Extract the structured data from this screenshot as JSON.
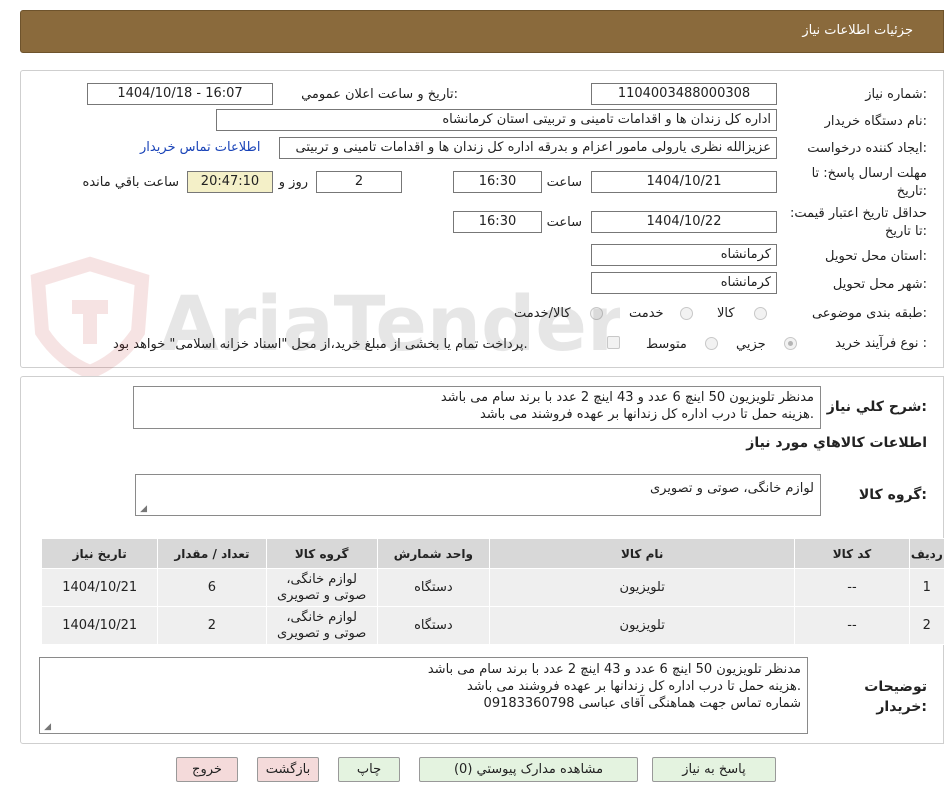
{
  "header": {
    "title": "جزئیات اطلاعات نیاز"
  },
  "form": {
    "need_number_label": "شماره نیاز:",
    "need_number": "1104003488000308",
    "announce_label": "تاریخ و ساعت اعلان عمومي:",
    "announce_value": "1404/10/18 - 16:07",
    "buyer_org_label": "نام دستگاه خریدار:",
    "buyer_org": "اداره کل زندان ها و اقدامات تامینی و تربیتی استان کرمانشاه",
    "requester_label": "ایجاد کننده درخواست:",
    "requester": "عزیزالله نظری یارولی مامور اعزام و بدرقه اداره کل زندان ها و اقدامات تامینی و تربیتی",
    "buyer_contact_link": "اطلاعات تماس خریدار",
    "reply_deadline_label": "مهلت ارسال پاسخ: تا تاریخ:",
    "reply_date": "1404/10/21",
    "time_label": "ساعت",
    "reply_time": "16:30",
    "days": "2",
    "days_label": "روز و",
    "remaining_time": "20:47:10",
    "remaining_label": "ساعت باقي مانده",
    "price_validity_label": "حداقل تاریخ اعتبار قیمت: تا تاریخ:",
    "validity_date": "1404/10/22",
    "validity_time": "16:30",
    "province_label": "استان محل تحویل:",
    "province": "کرمانشاه",
    "city_label": "شهر محل تحویل:",
    "city": "کرمانشاه",
    "category_label": "طبقه بندی موضوعی:",
    "category_options": [
      "کالا",
      "خدمت",
      "کالا/خدمت"
    ],
    "process_label": "نوع فرآیند خرید :",
    "process_options": [
      "جزیي",
      "متوسط"
    ],
    "payment_note": "پرداخت تمام یا بخشی از مبلغ خرید،از محل \"اسناد خزانه اسلامی\" خواهد بود."
  },
  "summary": {
    "label": "شرح کلي نیاز:",
    "line1": "مدنظر تلویزیون 50 اینچ 6 عدد و 43 اینچ 2 عدد با برند سام می باشد",
    "line2": "هزینه حمل تا درب اداره کل زندانها بر عهده فروشند می باشد."
  },
  "goods": {
    "section_title": "اطلاعات کالاهاي مورد نیاز",
    "group_label": "گروه کالا:",
    "group_value": "لوازم خانگی، صوتی و تصویری",
    "columns": [
      "ردیف",
      "کد کالا",
      "نام کالا",
      "واحد شمارش",
      "گروه کالا",
      "تعداد / مقدار",
      "تاریخ نیاز"
    ],
    "rows": [
      {
        "idx": "1",
        "code": "--",
        "name": "تلویزیون",
        "unit": "دستگاه",
        "group_l1": "لوازم خانگی،",
        "group_l2": "صوتی و تصویری",
        "qty": "6",
        "date": "1404/10/21"
      },
      {
        "idx": "2",
        "code": "--",
        "name": "تلویزیون",
        "unit": "دستگاه",
        "group_l1": "لوازم خانگی،",
        "group_l2": "صوتی و تصویری",
        "qty": "2",
        "date": "1404/10/21"
      }
    ]
  },
  "buyer_notes": {
    "label_l1": "توضیحات",
    "label_l2": "خریدار:",
    "line1": "مدنظر تلویزیون 50 اینچ 6 عدد و 43 اینچ 2 عدد با برند سام می باشد",
    "line2": "هزینه حمل تا درب اداره کل زندانها بر عهده فروشند می باشد.",
    "line3": "شماره تماس جهت هماهنگی آقای عباسی 09183360798"
  },
  "buttons": {
    "reply": "پاسخ به نیاز",
    "attachments": "مشاهده مدارک پیوستي (0)",
    "print": "چاپ",
    "back": "بازگشت",
    "exit": "خروج"
  },
  "watermark": {
    "text": "AriaTender.neT"
  },
  "colors": {
    "header": "#8a6a3c",
    "link": "#1a44b8",
    "button_green": "#e4f3e0",
    "button_pink": "#f4dada",
    "remaining": "#f4f0c8"
  }
}
